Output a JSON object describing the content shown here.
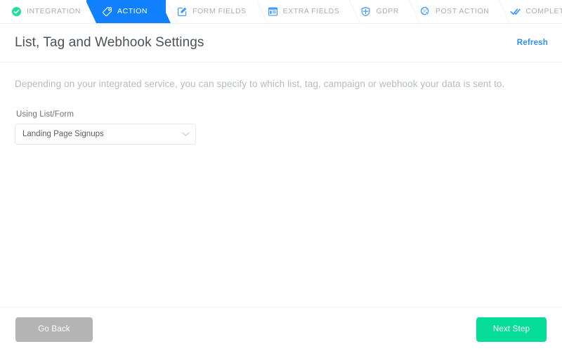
{
  "steps": [
    {
      "label": "INTEGRATION",
      "icon": "check-circle-icon",
      "state": "done"
    },
    {
      "label": "ACTION",
      "icon": "tag-icon",
      "state": "active"
    },
    {
      "label": "FORM FIELDS",
      "icon": "edit-square-icon",
      "state": "upcoming"
    },
    {
      "label": "EXTRA FIELDS",
      "icon": "window-list-icon",
      "state": "upcoming"
    },
    {
      "label": "GDPR",
      "icon": "shield-icon",
      "state": "upcoming"
    },
    {
      "label": "POST ACTION",
      "icon": "cursor-click-icon",
      "state": "upcoming"
    },
    {
      "label": "COMPLETE",
      "icon": "double-check-icon",
      "state": "upcoming"
    }
  ],
  "header": {
    "title": "List, Tag and Webhook Settings",
    "refresh_label": "Refresh"
  },
  "main": {
    "description": "Depending on your integrated service, you can specify to which list, tag, campaign or webhook your data is sent to.",
    "field": {
      "label": "Using List/Form",
      "value": "Landing Page Signups"
    }
  },
  "footer": {
    "back_label": "Go Back",
    "next_label": "Next Step"
  },
  "colors": {
    "active_step": "#1080ff",
    "done_step": "#22de9c",
    "link": "#2f8dfa",
    "next_button": "#06dd98",
    "back_button": "#b4b4b4"
  }
}
